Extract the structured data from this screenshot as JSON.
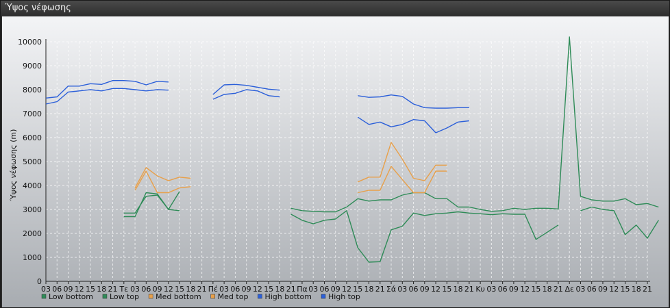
{
  "window": {
    "title": "Ύψος νέφωσης"
  },
  "chart_data": {
    "type": "line",
    "title": "",
    "xlabel": "",
    "ylabel": "Ύψος νέφωσης (m)",
    "ylim": [
      0,
      10000
    ],
    "yticks": [
      0,
      1000,
      2000,
      3000,
      4000,
      5000,
      6000,
      7000,
      8000,
      9000,
      10000
    ],
    "grid": true,
    "legend_position": "bottom-left",
    "categories": [
      "03",
      "06",
      "09",
      "12",
      "15",
      "18",
      "21",
      "Τε",
      "03",
      "06",
      "09",
      "12",
      "15",
      "18",
      "21",
      "Πέ",
      "03",
      "06",
      "09",
      "12",
      "15",
      "18",
      "21",
      "Πα",
      "03",
      "06",
      "09",
      "12",
      "15",
      "18",
      "21",
      "Σά",
      "03",
      "06",
      "09",
      "12",
      "15",
      "18",
      "21",
      "Κυ",
      "03",
      "06",
      "09",
      "12",
      "15",
      "18",
      "21",
      "Δε",
      "03",
      "06",
      "09",
      "12",
      "15",
      "18",
      "21"
    ],
    "series": [
      {
        "name": "Low bottom",
        "color": "#2e8b57",
        "values": [
          null,
          null,
          null,
          null,
          null,
          null,
          null,
          2700,
          2700,
          3700,
          3650,
          3000,
          2950,
          null,
          null,
          null,
          null,
          null,
          null,
          null,
          null,
          null,
          2800,
          2550,
          2400,
          2550,
          2600,
          2950,
          1400,
          800,
          820,
          2150,
          2300,
          2850,
          2750,
          2820,
          2850,
          2900,
          2850,
          2820,
          2780,
          2820,
          2800,
          2800,
          1750,
          2050,
          2350,
          null,
          2950,
          3100,
          3000,
          2950,
          1950,
          2350,
          1800,
          2550
        ]
      },
      {
        "name": "Low top",
        "color": "#2e8b57",
        "values": [
          null,
          null,
          null,
          null,
          null,
          null,
          null,
          2850,
          2850,
          3550,
          3600,
          3000,
          3750,
          null,
          null,
          null,
          null,
          null,
          null,
          null,
          null,
          null,
          3050,
          2950,
          2920,
          2900,
          2900,
          3100,
          3450,
          3350,
          3400,
          3400,
          3600,
          3700,
          3700,
          3450,
          3450,
          3100,
          3100,
          3000,
          2920,
          2950,
          3050,
          3000,
          3050,
          3050,
          3020,
          10200,
          3550,
          3400,
          3350,
          3350,
          3450,
          3200,
          3250,
          3100
        ]
      },
      {
        "name": "Med bottom",
        "color": "#e8a04a",
        "values": [
          null,
          null,
          null,
          null,
          null,
          null,
          null,
          null,
          3800,
          4600,
          3700,
          3700,
          3900,
          3950,
          null,
          null,
          null,
          null,
          null,
          null,
          null,
          null,
          null,
          null,
          null,
          null,
          null,
          null,
          3700,
          3800,
          3800,
          4800,
          4250,
          3700,
          3700,
          4600,
          4600,
          null,
          null,
          null,
          null,
          null,
          null,
          null,
          null,
          null,
          null,
          null,
          null,
          null,
          null,
          null,
          null,
          null,
          null,
          null
        ]
      },
      {
        "name": "Med top",
        "color": "#e8a04a",
        "values": [
          null,
          null,
          null,
          null,
          null,
          null,
          null,
          null,
          3900,
          4750,
          4400,
          4200,
          4350,
          4300,
          null,
          null,
          null,
          null,
          null,
          null,
          null,
          null,
          null,
          null,
          null,
          null,
          null,
          null,
          4150,
          4350,
          4350,
          5800,
          5100,
          4300,
          4200,
          4850,
          4850,
          null,
          null,
          null,
          null,
          null,
          null,
          null,
          null,
          null,
          null,
          null,
          null,
          null,
          null,
          null,
          null,
          null,
          null,
          null
        ]
      },
      {
        "name": "High bottom",
        "color": "#2b5fd9",
        "values": [
          7400,
          7500,
          7900,
          7950,
          8000,
          7950,
          8050,
          8050,
          8000,
          7950,
          8000,
          7980,
          null,
          null,
          null,
          7600,
          7800,
          7850,
          8000,
          7950,
          7750,
          7700,
          null,
          null,
          null,
          null,
          null,
          null,
          6850,
          6550,
          6650,
          6450,
          6550,
          6750,
          6700,
          6200,
          6400,
          6650,
          6700,
          null,
          null,
          null,
          null,
          null,
          null,
          null,
          null,
          null,
          null,
          null,
          null,
          null,
          null,
          null,
          null,
          null
        ]
      },
      {
        "name": "High top",
        "color": "#2b5fd9",
        "values": [
          7650,
          7700,
          8150,
          8150,
          8250,
          8220,
          8380,
          8380,
          8350,
          8200,
          8350,
          8320,
          null,
          null,
          null,
          7800,
          8200,
          8220,
          8180,
          8100,
          8020,
          7980,
          null,
          null,
          null,
          null,
          null,
          null,
          7750,
          7680,
          7700,
          7780,
          7720,
          7400,
          7250,
          7230,
          7230,
          7250,
          7250,
          null,
          null,
          null,
          null,
          null,
          null,
          null,
          null,
          null,
          null,
          null,
          null,
          null,
          null,
          null,
          null,
          null
        ]
      }
    ]
  }
}
